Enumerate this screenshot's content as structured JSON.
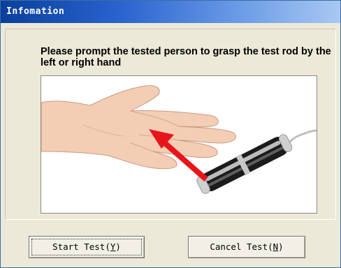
{
  "window": {
    "title": "Infomation"
  },
  "instruction": {
    "text": "Please prompt the tested person to grasp the test rod by the left or right hand"
  },
  "buttons": {
    "start": {
      "label": "Start Test(",
      "mnemonic": "Y",
      "suffix": ")"
    },
    "cancel": {
      "label": "Cancel Test(",
      "mnemonic": "N",
      "suffix": ")"
    }
  },
  "colors": {
    "title_bar_start": "#0a3f9c",
    "title_bar_end": "#a9c8f2",
    "dialog_bg": "#ece9d8",
    "arrow": "#e8141c"
  }
}
